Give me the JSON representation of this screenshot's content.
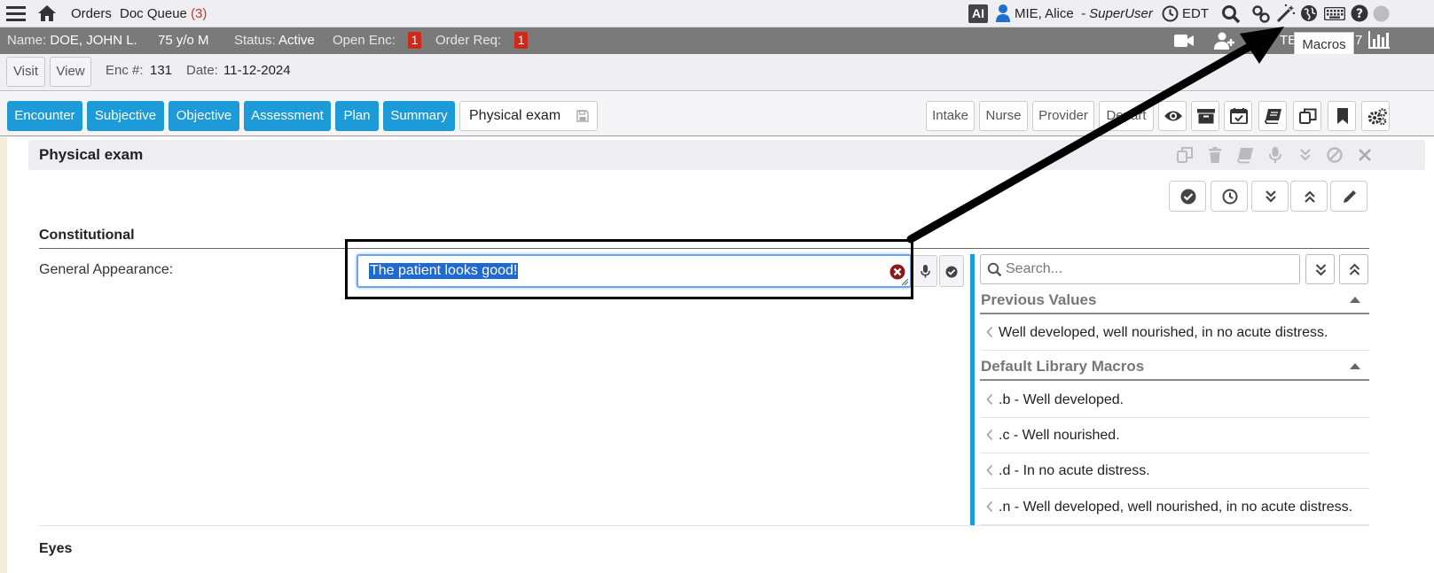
{
  "topnav": {
    "orders": "Orders",
    "doc_queue": "Doc Queue",
    "doc_queue_count": "(3)",
    "ai_badge": "AI",
    "user_name": "MIE, Alice",
    "user_role": "- SuperUser",
    "timezone": "EDT"
  },
  "patient": {
    "name_label": "Name:",
    "name": "DOE, JOHN L.",
    "age": "75 y/o M",
    "status_label": "Status:",
    "status": "Active",
    "open_enc_label": "Open Enc:",
    "open_enc_count": "1",
    "order_req_label": "Order Req:",
    "order_req_count": "1",
    "right_label": "TE",
    "right_num": "7"
  },
  "encounter": {
    "visit_btn": "Visit",
    "view_btn": "View",
    "enc_label": "Enc #:",
    "enc_num": "131",
    "date_label": "Date:",
    "date": "11-12-2024"
  },
  "tabs": {
    "items": [
      "Encounter",
      "Subjective",
      "Objective",
      "Assessment",
      "Plan",
      "Summary"
    ],
    "current_section": "Physical exam",
    "right_buttons": [
      "Intake",
      "Nurse",
      "Provider",
      "Depart"
    ]
  },
  "tooltip": {
    "text": "Macros"
  },
  "physical_exam": {
    "title": "Physical exam",
    "section": "Constitutional",
    "field_label": "General Appearance:",
    "field_value": "The patient looks good!",
    "next_section": "Eyes"
  },
  "macros_panel": {
    "search_placeholder": "Search...",
    "previous_header": "Previous Values",
    "previous_items": [
      "Well developed, well nourished, in no acute distress."
    ],
    "library_header": "Default Library Macros",
    "library_items": [
      ".b - Well developed.",
      ".c - Well nourished.",
      ".d - In no acute distress.",
      ".n - Well developed, well nourished, in no acute distress."
    ]
  },
  "colors": {
    "tab_blue": "#1d9bd8",
    "patient_bar": "#7a7a7a",
    "badge_red": "#cc2a1b",
    "selection": "#1e6ad0"
  }
}
